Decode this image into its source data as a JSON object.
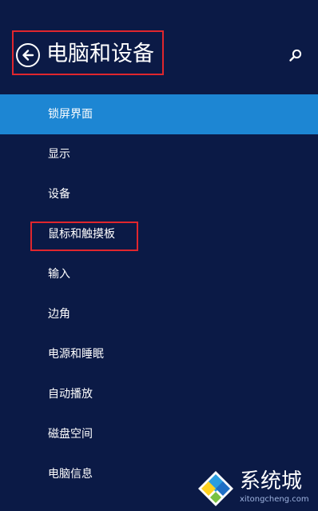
{
  "header": {
    "title": "电脑和设备",
    "back_icon": "back-arrow-icon",
    "search_icon": "search-icon"
  },
  "menu": {
    "items": [
      {
        "label": "锁屏界面",
        "selected": true
      },
      {
        "label": "显示",
        "selected": false
      },
      {
        "label": "设备",
        "selected": false
      },
      {
        "label": "鼠标和触摸板",
        "selected": false
      },
      {
        "label": "输入",
        "selected": false
      },
      {
        "label": "边角",
        "selected": false
      },
      {
        "label": "电源和睡眠",
        "selected": false
      },
      {
        "label": "自动播放",
        "selected": false
      },
      {
        "label": "磁盘空间",
        "selected": false
      },
      {
        "label": "电脑信息",
        "selected": false
      }
    ]
  },
  "watermark": {
    "text": "系统城",
    "subtext": "xitongcheng.com"
  },
  "colors": {
    "background": "#0b1a46",
    "selected": "#1d86d3",
    "annotation": "#e0262d",
    "text": "#ffffff"
  }
}
